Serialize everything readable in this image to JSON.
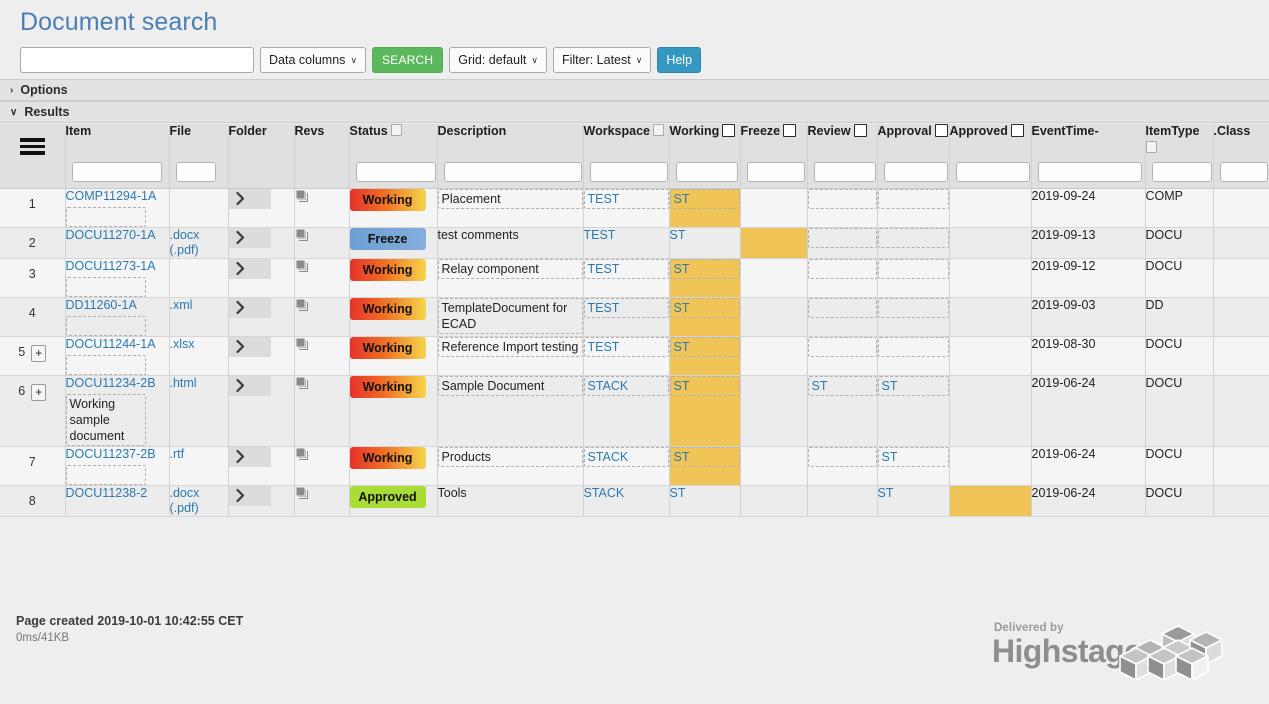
{
  "page": {
    "title": "Document search"
  },
  "toolbar": {
    "search_value": "",
    "search_placeholder": "",
    "data_columns_label": "Data columns",
    "search_button_label": "SEARCH",
    "grid_label": "Grid: default",
    "filter_label": "Filter: Latest",
    "help_label": "Help",
    "chevron": "∨"
  },
  "sections": {
    "options": {
      "label": "Options",
      "icon": "›",
      "expanded": false
    },
    "results": {
      "label": "Results",
      "icon": "∨",
      "expanded": true
    }
  },
  "grid": {
    "menu_icon": "hamburger-icon",
    "columns": [
      {
        "key": "menu",
        "label": "",
        "filter": "",
        "has_mini": false,
        "has_checkbox": false
      },
      {
        "key": "item",
        "label": "Item",
        "filter": "",
        "has_mini": false,
        "has_checkbox": false
      },
      {
        "key": "file",
        "label": "File",
        "filter": "",
        "has_mini": false,
        "has_checkbox": false
      },
      {
        "key": "folder",
        "label": "Folder",
        "filter": null,
        "has_mini": false,
        "has_checkbox": false
      },
      {
        "key": "revs",
        "label": "Revs",
        "filter": null,
        "has_mini": false,
        "has_checkbox": false
      },
      {
        "key": "status",
        "label": "Status",
        "filter": "",
        "has_mini": true,
        "has_checkbox": false
      },
      {
        "key": "description",
        "label": "Description",
        "filter": "",
        "has_mini": false,
        "has_checkbox": false
      },
      {
        "key": "workspace",
        "label": "Workspace",
        "filter": "",
        "has_mini": true,
        "has_checkbox": false
      },
      {
        "key": "working",
        "label": "Working",
        "filter": "",
        "has_mini": false,
        "has_checkbox": true
      },
      {
        "key": "freeze",
        "label": "Freeze",
        "filter": "",
        "has_mini": false,
        "has_checkbox": true
      },
      {
        "key": "review",
        "label": "Review",
        "filter": "",
        "has_mini": false,
        "has_checkbox": true
      },
      {
        "key": "approval",
        "label": "Approval",
        "filter": "",
        "has_mini": false,
        "has_checkbox": true
      },
      {
        "key": "approved",
        "label": "Approved",
        "filter": "",
        "has_mini": false,
        "has_checkbox": true
      },
      {
        "key": "eventtime",
        "label": "EventTime-",
        "filter": "",
        "has_mini": false,
        "has_checkbox": false
      },
      {
        "key": "itemtype",
        "label": "ItemType",
        "filter": "",
        "has_mini": true,
        "has_checkbox": false
      },
      {
        "key": "class",
        "label": ".Class",
        "filter": "",
        "has_mini": false,
        "has_checkbox": false
      }
    ],
    "rows": [
      {
        "num": "1",
        "expandable": false,
        "expand_label": "+",
        "item": "COMP11294-1A",
        "item_sub": "",
        "item_sub_boxed": true,
        "file": "",
        "file2": "",
        "status": "Working",
        "status_kind": "working",
        "description": "Placement",
        "description_boxed": true,
        "workspace": "TEST",
        "workspace_boxed": true,
        "working": "ST",
        "working_boxed": true,
        "working_hl": true,
        "freeze": "",
        "freeze_boxed": false,
        "freeze_hl": false,
        "review": "",
        "review_boxed": true,
        "review_hl": false,
        "approval": "",
        "approval_boxed": true,
        "approval_hl": false,
        "approved": "",
        "approved_boxed": false,
        "approved_hl": false,
        "eventtime": "2019-09-24",
        "itemtype": "COMP",
        "class": ""
      },
      {
        "num": "2",
        "expandable": false,
        "expand_label": "+",
        "item": "DOCU11270-1A",
        "item_sub": "",
        "item_sub_boxed": false,
        "file": ".docx",
        "file2": "(.pdf)",
        "status": "Freeze",
        "status_kind": "freeze",
        "description": "test comments",
        "description_boxed": false,
        "workspace": "TEST",
        "workspace_boxed": false,
        "working": "ST",
        "working_boxed": false,
        "working_hl": false,
        "freeze": "",
        "freeze_boxed": false,
        "freeze_hl": true,
        "review": "",
        "review_boxed": true,
        "review_hl": false,
        "approval": "",
        "approval_boxed": true,
        "approval_hl": false,
        "approved": "",
        "approved_boxed": false,
        "approved_hl": false,
        "eventtime": "2019-09-13",
        "itemtype": "DOCU",
        "class": ""
      },
      {
        "num": "3",
        "expandable": false,
        "expand_label": "+",
        "item": "DOCU11273-1A",
        "item_sub": "",
        "item_sub_boxed": true,
        "file": "",
        "file2": "",
        "status": "Working",
        "status_kind": "working",
        "description": "Relay component",
        "description_boxed": true,
        "workspace": "TEST",
        "workspace_boxed": true,
        "working": "ST",
        "working_boxed": true,
        "working_hl": true,
        "freeze": "",
        "freeze_boxed": false,
        "freeze_hl": false,
        "review": "",
        "review_boxed": true,
        "review_hl": false,
        "approval": "",
        "approval_boxed": true,
        "approval_hl": false,
        "approved": "",
        "approved_boxed": false,
        "approved_hl": false,
        "eventtime": "2019-09-12",
        "itemtype": "DOCU",
        "class": ""
      },
      {
        "num": "4",
        "expandable": false,
        "expand_label": "+",
        "item": "DD11260-1A",
        "item_sub": "",
        "item_sub_boxed": true,
        "file": ".xml",
        "file2": "",
        "status": "Working",
        "status_kind": "working",
        "description": "TemplateDocument for ECAD",
        "description_boxed": true,
        "workspace": "TEST",
        "workspace_boxed": true,
        "working": "ST",
        "working_boxed": true,
        "working_hl": true,
        "freeze": "",
        "freeze_boxed": false,
        "freeze_hl": false,
        "review": "",
        "review_boxed": true,
        "review_hl": false,
        "approval": "",
        "approval_boxed": true,
        "approval_hl": false,
        "approved": "",
        "approved_boxed": false,
        "approved_hl": false,
        "eventtime": "2019-09-03",
        "itemtype": "DD",
        "class": ""
      },
      {
        "num": "5",
        "expandable": true,
        "expand_label": "+",
        "item": "DOCU11244-1A",
        "item_sub": "",
        "item_sub_boxed": true,
        "file": ".xlsx",
        "file2": "",
        "status": "Working",
        "status_kind": "working",
        "description": "Reference Import testing",
        "description_boxed": true,
        "workspace": "TEST",
        "workspace_boxed": true,
        "working": "ST",
        "working_boxed": true,
        "working_hl": true,
        "freeze": "",
        "freeze_boxed": false,
        "freeze_hl": false,
        "review": "",
        "review_boxed": true,
        "review_hl": false,
        "approval": "",
        "approval_boxed": true,
        "approval_hl": false,
        "approved": "",
        "approved_boxed": false,
        "approved_hl": false,
        "eventtime": "2019-08-30",
        "itemtype": "DOCU",
        "class": ""
      },
      {
        "num": "6",
        "expandable": true,
        "expand_label": "+",
        "item": "DOCU11234-2B",
        "item_sub": "Working sample document",
        "item_sub_boxed": true,
        "file": ".html",
        "file2": "",
        "status": "Working",
        "status_kind": "working",
        "description": "Sample Document",
        "description_boxed": true,
        "workspace": "STACK",
        "workspace_boxed": true,
        "working": "ST",
        "working_boxed": true,
        "working_hl": true,
        "freeze": "",
        "freeze_boxed": false,
        "freeze_hl": false,
        "review": "ST",
        "review_boxed": true,
        "review_hl": false,
        "approval": "ST",
        "approval_boxed": true,
        "approval_hl": false,
        "approved": "",
        "approved_boxed": false,
        "approved_hl": false,
        "eventtime": "2019-06-24",
        "itemtype": "DOCU",
        "class": ""
      },
      {
        "num": "7",
        "expandable": false,
        "expand_label": "+",
        "item": "DOCU11237-2B",
        "item_sub": "",
        "item_sub_boxed": true,
        "file": ".rtf",
        "file2": "",
        "status": "Working",
        "status_kind": "working",
        "description": "Products",
        "description_boxed": true,
        "workspace": "STACK",
        "workspace_boxed": true,
        "working": "ST",
        "working_boxed": true,
        "working_hl": true,
        "freeze": "",
        "freeze_boxed": false,
        "freeze_hl": false,
        "review": "",
        "review_boxed": true,
        "review_hl": false,
        "approval": "ST",
        "approval_boxed": true,
        "approval_hl": false,
        "approved": "",
        "approved_boxed": false,
        "approved_hl": false,
        "eventtime": "2019-06-24",
        "itemtype": "DOCU",
        "class": ""
      },
      {
        "num": "8",
        "expandable": false,
        "expand_label": "+",
        "item": "DOCU11238-2",
        "item_sub": "",
        "item_sub_boxed": false,
        "file": ".docx",
        "file2": "(.pdf)",
        "status": "Approved",
        "status_kind": "approved",
        "description": "Tools",
        "description_boxed": false,
        "workspace": "STACK",
        "workspace_boxed": false,
        "working": "ST",
        "working_boxed": false,
        "working_hl": false,
        "freeze": "",
        "freeze_boxed": false,
        "freeze_hl": false,
        "review": "",
        "review_boxed": false,
        "review_hl": false,
        "approval": "ST",
        "approval_boxed": false,
        "approval_hl": false,
        "approved": "",
        "approved_boxed": false,
        "approved_hl": true,
        "eventtime": "2019-06-24",
        "itemtype": "DOCU",
        "class": ""
      }
    ]
  },
  "footer": {
    "created": "Page created 2019-10-01 10:42:55 CET",
    "performance": "0ms/41KB",
    "logo_tagline": "Delivered by",
    "logo_name": "Highstage"
  },
  "colors": {
    "accent_blue": "#4a7fb5",
    "link_blue": "#2a7ab0",
    "search_green": "#5cb85c",
    "help_blue": "#3498c0",
    "highlight_orange": "#f0c457",
    "badge_working_from": "#e5322c",
    "badge_working_to": "#f6d54b",
    "badge_freeze": "#6e9ed2",
    "badge_approved": "#a9dd35"
  }
}
